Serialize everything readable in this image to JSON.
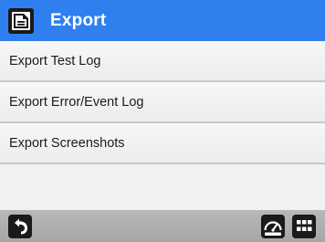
{
  "header": {
    "title": "Export",
    "icon": "export-document-icon",
    "color": "#2f80ee"
  },
  "menu": {
    "items": [
      {
        "label": "Export Test Log"
      },
      {
        "label": "Export Error/Event Log"
      },
      {
        "label": "Export Screenshots"
      }
    ]
  },
  "toolbar": {
    "back_icon": "back-arrow-icon",
    "gauge_icon": "gauge-icon",
    "grid_icon": "grid-menu-icon"
  }
}
